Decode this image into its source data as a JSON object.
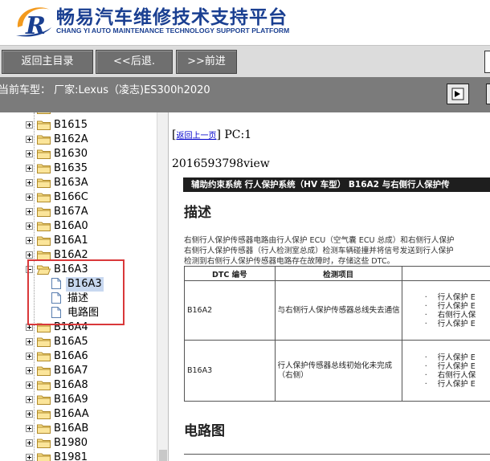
{
  "header": {
    "title": "畅易汽车维修技术支持平台",
    "subtitle": "CHANG YI AUTO MAINTENANCE TECHNOLOGY SUPPORT PLATFORM",
    "logo_letter": "R",
    "brand_color": "#1a3f91",
    "logo_color": "#f39a1e"
  },
  "toolbar": {
    "home_label": "返回主目录",
    "back_label": "<<后退.",
    "forward_label": ">>前进"
  },
  "vehicle": {
    "label": "当前车型：  厂家:Lexus（凌志)ES300h2020"
  },
  "tree": {
    "nodes_before": [
      "B1615",
      "B162A",
      "B1630",
      "B1635",
      "B163A",
      "B166C",
      "B167A",
      "B16A0",
      "B16A1",
      "B16A2"
    ],
    "expanded": {
      "label": "B16A3",
      "children": [
        "B16A3",
        "描述",
        "电路图"
      ]
    },
    "nodes_after": [
      "B16A4",
      "B16A5",
      "B16A6",
      "B16A7",
      "B16A8",
      "B16A9",
      "B16AA",
      "B16AB",
      "B1980",
      "B1981"
    ],
    "highlight_color": "#d9383a"
  },
  "content": {
    "return_link": "返回上一页",
    "page_counter": "PC:1",
    "doc_id": "2016593798view",
    "band": "辅助约束系统  行人保护系统（HV 车型）  B16A2  与右侧行人保护传",
    "desc_heading": "描述",
    "desc_lines": [
      "右侧行人保护传感器电路由行人保护 ECU（空气囊 ECU 总成）和右侧行人保护",
      "右侧行人保护传感器（行人检测室总成）检测车辆碰撞并将信号发送到行人保护",
      "检测到右侧行人保护传感器电路存在故障时，存储这些 DTC。"
    ],
    "table": {
      "headers": [
        "DTC 编号",
        "检测项目",
        ""
      ],
      "rows": [
        {
          "code": "B16A2",
          "item": "与右侧行人保护传感器总线失去通信",
          "conditions": [
            "行人保护 E",
            "行人保护 E",
            "右侧行人保",
            "行人保护 E"
          ]
        },
        {
          "code": "B16A3",
          "item": "行人保护传感器总线初始化未完成（右侧）",
          "conditions": [
            "行人保护 E",
            "行人保护 E",
            "右侧行人保",
            "行人保护 E"
          ]
        }
      ]
    },
    "circuit_heading": "电路图"
  }
}
